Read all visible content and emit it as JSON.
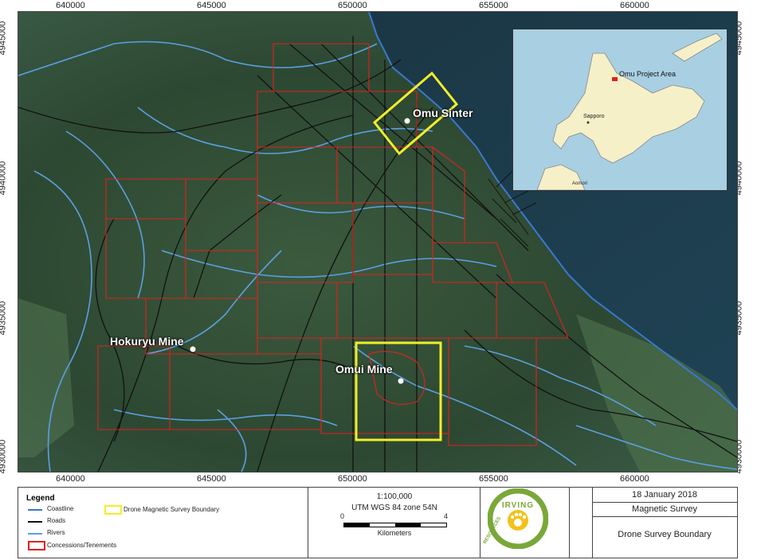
{
  "axes": {
    "x_ticks": [
      "640000",
      "645000",
      "650000",
      "655000",
      "660000"
    ],
    "y_ticks": [
      "4945000",
      "4940000",
      "4935000",
      "4930000"
    ]
  },
  "places": {
    "omu_sinter": "Omu Sinter",
    "hokuryu_mine": "Hokuryu Mine",
    "omui_mine": "Omui Mine"
  },
  "inset": {
    "project_label": "Omu Project Area",
    "city1": "Sapporo",
    "city2": "Aomori"
  },
  "legend": {
    "title": "Legend",
    "items": {
      "coastline": "Coastline",
      "roads": "Roads",
      "rivers": "Rivers",
      "concessions": "Concessions/Tenements",
      "drone_boundary": "Drone Magnetic Survey Boundary"
    }
  },
  "scale": {
    "ratio": "1:100,000",
    "projection": "UTM WGS 84 zone 54N",
    "start": "0",
    "end": "4",
    "unit": "Kilometers"
  },
  "logo": {
    "text_top": "IRVING",
    "text_side": "RESOURCES"
  },
  "title_block": {
    "date": "18 January 2018",
    "survey": "Magnetic Survey",
    "subject": "Drone Survey Boundary"
  },
  "colors": {
    "land": "#2f4a35",
    "sea": "#1c3a4a",
    "concession": "#e02020",
    "drone": "#f2ee2a",
    "river": "#5aa0e0",
    "road": "#111111"
  }
}
